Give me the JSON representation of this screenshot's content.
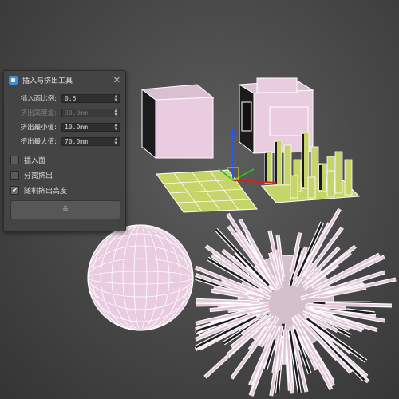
{
  "dialog": {
    "title": "插入与挤出工具",
    "close_glyph": "✕",
    "fields": [
      {
        "label": "插入面比例:",
        "value": "0.5",
        "enabled": true
      },
      {
        "label": "挤出高度量:",
        "value": "30.0mm",
        "enabled": false
      },
      {
        "label": "挤出最小值:",
        "value": "10.0mm",
        "enabled": true
      },
      {
        "label": "挤出最大值:",
        "value": "70.0mm",
        "enabled": true
      }
    ],
    "checkboxes": [
      {
        "label": "插入面",
        "checked": false
      },
      {
        "label": "分离挤出",
        "checked": false
      },
      {
        "label": "随机挤出高度",
        "checked": true
      }
    ],
    "check_glyph": "✔",
    "apply_label": "≚"
  },
  "colors": {
    "mesh_pink": "#e9ccdf",
    "mesh_green": "#c6d56a",
    "wire": "#ffffff",
    "dark_face": "#1b1b1b"
  }
}
